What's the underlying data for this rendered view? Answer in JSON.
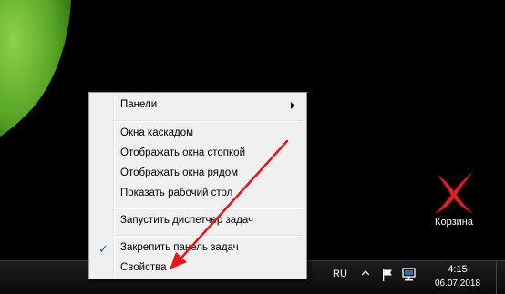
{
  "desktop": {
    "recycle_bin_label": "Корзина"
  },
  "context_menu": {
    "items": [
      {
        "label": "Панели",
        "has_submenu": true
      },
      {
        "label": "Окна каскадом"
      },
      {
        "label": "Отображать окна стопкой"
      },
      {
        "label": "Отображать окна рядом"
      },
      {
        "label": "Показать рабочий стол"
      },
      {
        "label": "Запустить диспетчер задач"
      },
      {
        "label": "Закрепить панель задач",
        "checked": true
      },
      {
        "label": "Свойства"
      }
    ]
  },
  "taskbar": {
    "language": "RU",
    "time": "4:15",
    "date": "06.07.2018"
  },
  "colors": {
    "annotation_arrow": "#e8141a",
    "menu_background": "#f0f0f0",
    "check_mark": "#1e54b4"
  },
  "icons": [
    "chevron-up-icon",
    "flag-icon",
    "network-icon",
    "recycle-bin-icon",
    "check-icon",
    "submenu-arrow-icon"
  ]
}
